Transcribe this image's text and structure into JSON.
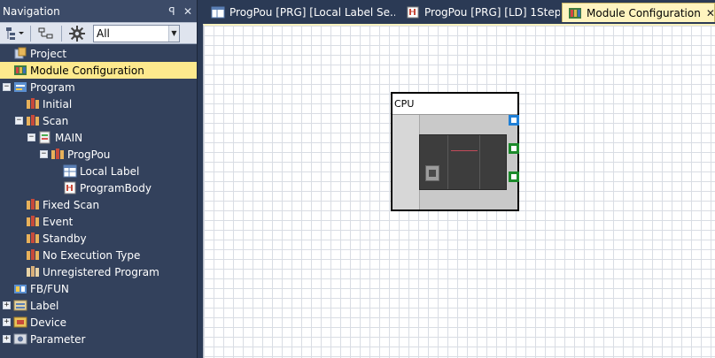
{
  "nav": {
    "title": "Navigation",
    "pin_label": "ꟼ",
    "close_label": "✕",
    "filter_value": "All",
    "tree": [
      {
        "label": "Project"
      },
      {
        "label": "Module Configuration"
      },
      {
        "label": "Program"
      },
      {
        "label": "Initial"
      },
      {
        "label": "Scan"
      },
      {
        "label": "MAIN"
      },
      {
        "label": "ProgPou"
      },
      {
        "label": "Local Label"
      },
      {
        "label": "ProgramBody"
      },
      {
        "label": "Fixed Scan"
      },
      {
        "label": "Event"
      },
      {
        "label": "Standby"
      },
      {
        "label": "No Execution Type"
      },
      {
        "label": "Unregistered Program"
      },
      {
        "label": "FB/FUN"
      },
      {
        "label": "Label"
      },
      {
        "label": "Device"
      },
      {
        "label": "Parameter"
      }
    ]
  },
  "tabs": [
    {
      "label": "ProgPou [PRG] [Local Label Se..."
    },
    {
      "label": "ProgPou [PRG] [LD] 1Step"
    },
    {
      "label": "Module Configuration"
    }
  ],
  "module": {
    "caption": "CPU"
  },
  "colors": {
    "panel_bg": "#33415c",
    "selected_bg": "#fde98d",
    "active_tab_bg": "#fff4bf",
    "connector_blue": "#1e7fd6",
    "connector_green": "#1b8a2a"
  },
  "icons": {
    "toolbar": [
      "tree-view-icon",
      "sort-icon",
      "gear-icon"
    ]
  }
}
